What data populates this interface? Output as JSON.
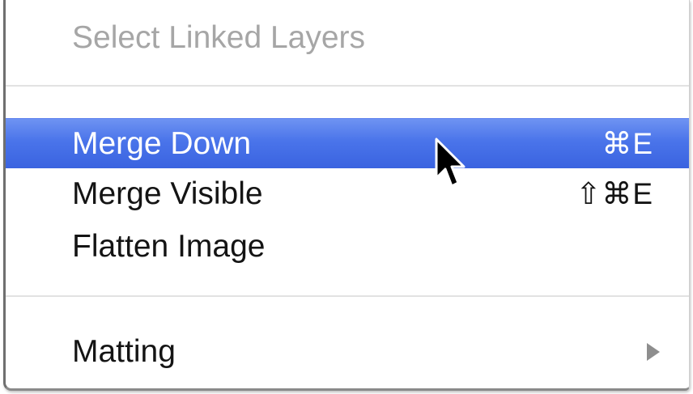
{
  "menu": {
    "items": [
      {
        "label": "Select Linked Layers",
        "shortcut": "",
        "state": "disabled"
      },
      {
        "label": "Merge Down",
        "shortcut": "⌘E",
        "state": "selected"
      },
      {
        "label": "Merge Visible",
        "shortcut": "⇧⌘E",
        "state": "normal"
      },
      {
        "label": "Flatten Image",
        "shortcut": "",
        "state": "normal"
      },
      {
        "label": "Matting",
        "shortcut": "",
        "state": "normal",
        "has_submenu": true
      }
    ]
  },
  "colors": {
    "selection": "#3f6ae4",
    "text": "#141414",
    "disabled_text": "#a6a6a6",
    "separator": "#e2e2e2"
  },
  "icons": {
    "cursor": "arrow-pointer-icon",
    "submenu": "submenu-arrow-icon"
  }
}
